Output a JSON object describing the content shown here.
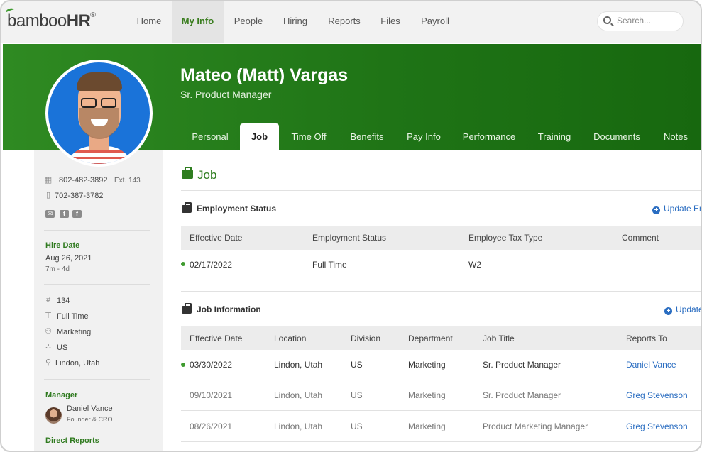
{
  "brand": {
    "logo_main": "bamboo",
    "logo_hr": "HR",
    "logo_reg": "®"
  },
  "nav": {
    "items": [
      {
        "label": "Home"
      },
      {
        "label": "My Info",
        "active": true
      },
      {
        "label": "People"
      },
      {
        "label": "Hiring"
      },
      {
        "label": "Reports"
      },
      {
        "label": "Files"
      },
      {
        "label": "Payroll"
      }
    ],
    "search_placeholder": "Search..."
  },
  "employee": {
    "name": "Mateo (Matt) Vargas",
    "title": "Sr. Product Manager"
  },
  "tabs": [
    {
      "label": "Personal"
    },
    {
      "label": "Job",
      "active": true
    },
    {
      "label": "Time Off"
    },
    {
      "label": "Benefits"
    },
    {
      "label": "Pay Info"
    },
    {
      "label": "Performance"
    },
    {
      "label": "Training"
    },
    {
      "label": "Documents"
    },
    {
      "label": "Notes"
    }
  ],
  "sidebar": {
    "work_phone": "802-482-3892",
    "work_ext": "Ext. 143",
    "mobile_phone": "702-387-3782",
    "hire_date_label": "Hire Date",
    "hire_date": "Aug 26, 2021",
    "tenure": "7m - 4d",
    "employee_number": "134",
    "employment_type": "Full Time",
    "department": "Marketing",
    "division": "US",
    "location": "Lindon, Utah",
    "manager_label": "Manager",
    "manager_name": "Daniel Vance",
    "manager_title": "Founder & CRO",
    "direct_reports_label": "Direct Reports"
  },
  "main": {
    "section_title": "Job",
    "employment_status": {
      "title": "Employment Status",
      "update_label": "Update Em",
      "columns": [
        "Effective Date",
        "Employment Status",
        "Employee Tax Type",
        "Comment"
      ],
      "rows": [
        {
          "effective_date": "02/17/2022",
          "status": "Full Time",
          "tax_type": "W2",
          "comment": "",
          "current": true
        }
      ]
    },
    "job_information": {
      "title": "Job Information",
      "update_label": "Update",
      "columns": [
        "Effective Date",
        "Location",
        "Division",
        "Department",
        "Job Title",
        "Reports To"
      ],
      "rows": [
        {
          "effective_date": "03/30/2022",
          "location": "Lindon, Utah",
          "division": "US",
          "department": "Marketing",
          "job_title": "Sr. Product Manager",
          "reports_to": "Daniel Vance",
          "current": true
        },
        {
          "effective_date": "09/10/2021",
          "location": "Lindon, Utah",
          "division": "US",
          "department": "Marketing",
          "job_title": "Sr. Product Manager",
          "reports_to": "Greg Stevenson",
          "current": false
        },
        {
          "effective_date": "08/26/2021",
          "location": "Lindon, Utah",
          "division": "US",
          "department": "Marketing",
          "job_title": "Product Marketing Manager",
          "reports_to": "Greg Stevenson",
          "current": false
        }
      ]
    }
  },
  "colors": {
    "brand_green": "#2e7d1f",
    "link_blue": "#2a6dc1"
  }
}
